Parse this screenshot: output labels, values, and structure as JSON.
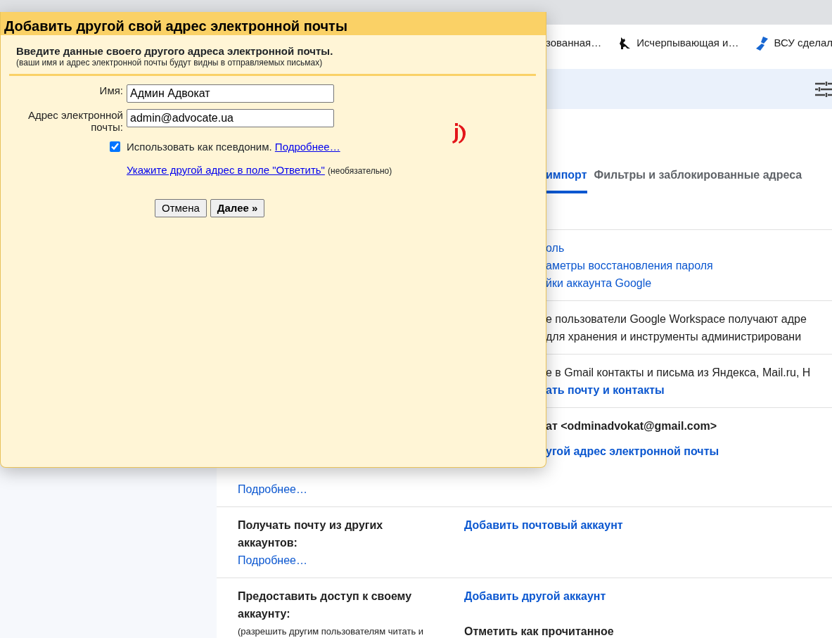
{
  "browser": {
    "bookmarks": [
      {
        "label": "зованная…"
      },
      {
        "label": "Исчерпывающая и…"
      },
      {
        "label": "ВСУ сделал"
      }
    ]
  },
  "settings_tabs": [
    {
      "label": "импорт",
      "selected": true
    },
    {
      "label": "Фильтры и заблокированные адреса",
      "selected": false
    }
  ],
  "sections": [
    {
      "right": [
        {
          "text": "оль",
          "kind": "link"
        },
        {
          "text": "аметры восстановления пароля",
          "kind": "link"
        },
        {
          "text": "йки аккаунта Google",
          "kind": "link"
        }
      ]
    },
    {
      "right": [
        {
          "text": "е пользователи Google Workspace получают адре",
          "kind": "text"
        },
        {
          "text": "для хранения и инструменты администрировани",
          "kind": "text"
        }
      ]
    },
    {
      "right": [
        {
          "text": "е в Gmail контакты и письма из Яндекса, Mail.ru, Н",
          "kind": "text"
        },
        {
          "text": "ать почту и контакты",
          "kind": "bold_link"
        }
      ]
    },
    {
      "left": [
        {
          "text": "Подробнее…",
          "kind": "link"
        }
      ],
      "right": [
        {
          "text": "ат <odminadvokat@gmail.com>",
          "kind": "bold"
        },
        {
          "text": "угой адрес электронной почты",
          "kind": "bold_link"
        }
      ]
    },
    {
      "left": [
        {
          "text": "Получать почту из других аккаунтов:",
          "kind": "heading"
        },
        {
          "text": "Подробнее…",
          "kind": "link"
        }
      ],
      "right": [
        {
          "text": "Добавить почтовый аккаунт",
          "kind": "bold_link"
        }
      ]
    },
    {
      "left": [
        {
          "text": "Предоставить доступ к своему аккаунту:",
          "kind": "heading"
        },
        {
          "text": "(разрешить другим пользователям читать и",
          "kind": "note"
        }
      ],
      "right": [
        {
          "text": "Добавить другой аккаунт",
          "kind": "bold_link"
        },
        {
          "text": "Отметить как прочитанное",
          "kind": "bold"
        }
      ]
    }
  ],
  "dialog": {
    "title": "Добавить другой свой адрес электронной почты",
    "intro": "Введите данные своего другого адреса электронной почты.",
    "intro_note": "(ваши имя и адрес электронной почты будут видны в отправляемых письмах)",
    "fields": [
      {
        "label": "Имя:",
        "value": "Админ Адвокат"
      },
      {
        "label": "Адрес электронной почты:",
        "value": "admin@advocate.ua"
      }
    ],
    "alias": {
      "checked": true,
      "label": "Использовать как псевдоним.",
      "link": "Подробнее…"
    },
    "reply_to": {
      "link": "Укажите другой адрес в поле \"Ответить\"",
      "note": "(необязательно)"
    },
    "buttons": [
      {
        "label": "Отмена",
        "kind": "default"
      },
      {
        "label": "Далее »",
        "kind": "primary"
      }
    ]
  }
}
